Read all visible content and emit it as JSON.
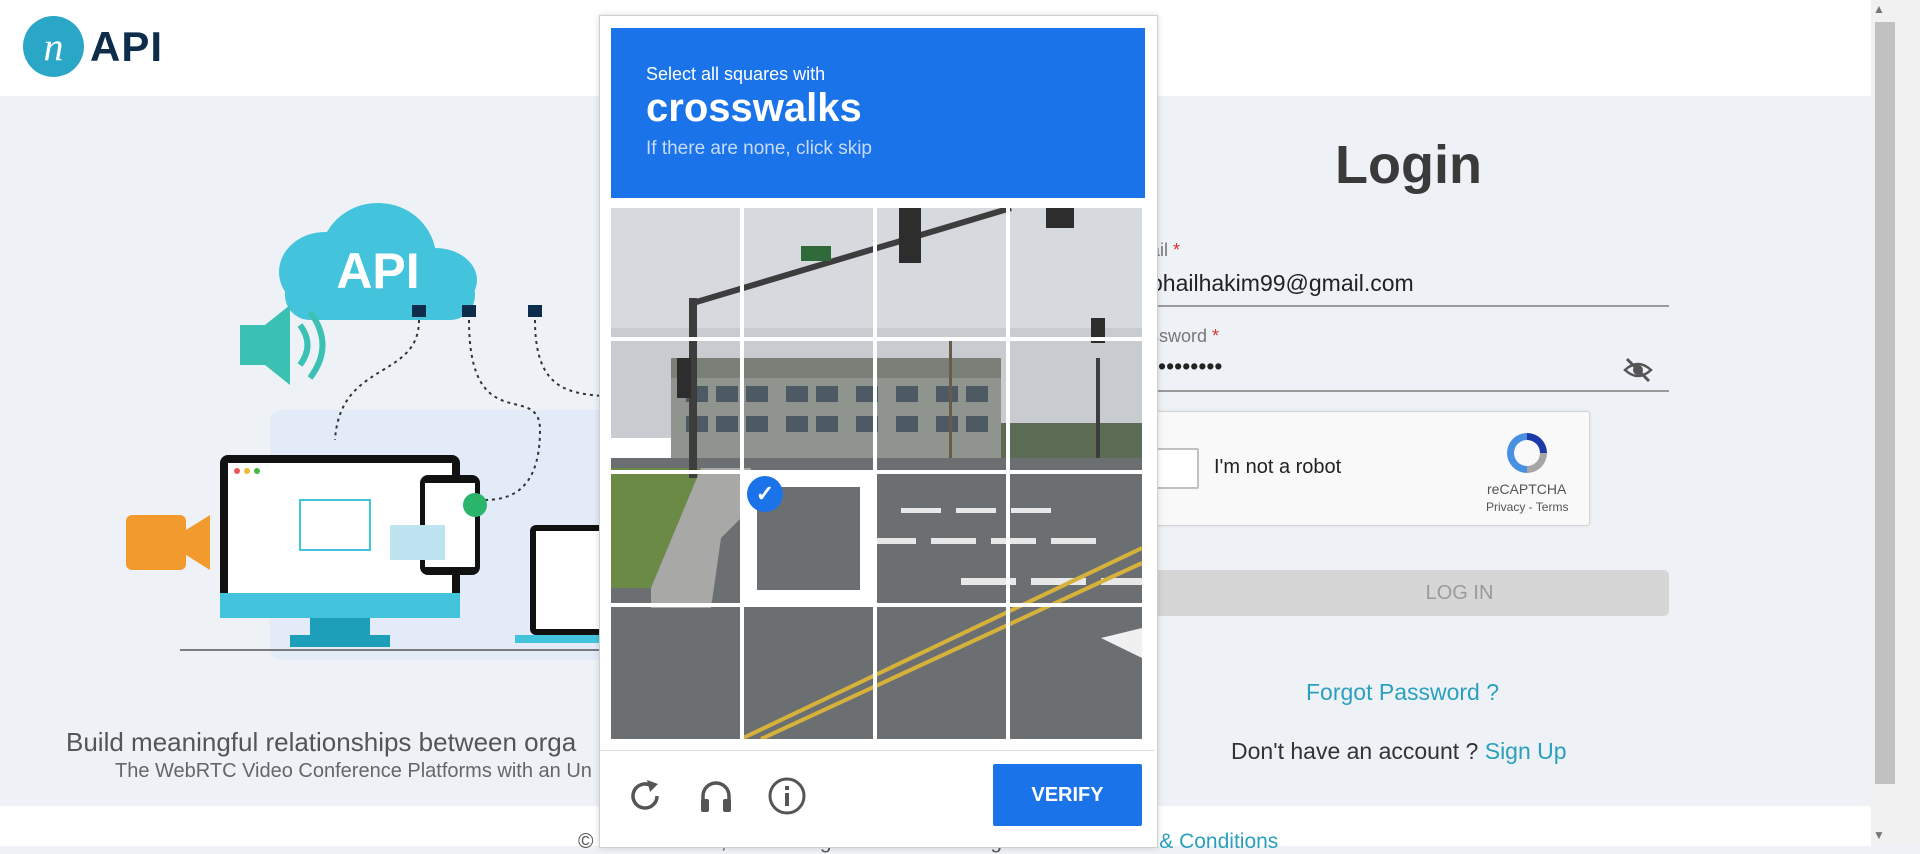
{
  "header": {
    "logo_letter": "n",
    "logo_text": "API"
  },
  "illustration": {
    "cloud_label": "API"
  },
  "tagline": "Build meaningful relationships between orga",
  "subtagline": "The WebRTC Video Conference Platforms with an Un",
  "login": {
    "title": "Login",
    "email_label": "ail",
    "email_value": "ohailhakim99@gmail.com",
    "password_label": "ssword",
    "password_value": "•••••••••",
    "required_mark": "*",
    "recaptcha_label": "I'm not a robot",
    "recaptcha_brand": "reCAPTCHA",
    "recaptcha_terms": "Privacy - Terms",
    "login_button": "LOG IN",
    "forgot_password": "Forgot Password ?",
    "no_account": "Don't have an account ?",
    "sign_up": "Sign Up"
  },
  "footer": {
    "text": "© 2024 nSocial, Inc. All Rights Reserved. I agree to the",
    "link": "Terms & Conditions"
  },
  "captcha": {
    "instruction": "Select all squares with",
    "target": "crosswalks",
    "hint": "If there are none, click skip",
    "verify_button": "VERIFY",
    "selected_tile": 9,
    "colors": {
      "header": "#1a73e8",
      "button": "#1a73e8"
    }
  }
}
